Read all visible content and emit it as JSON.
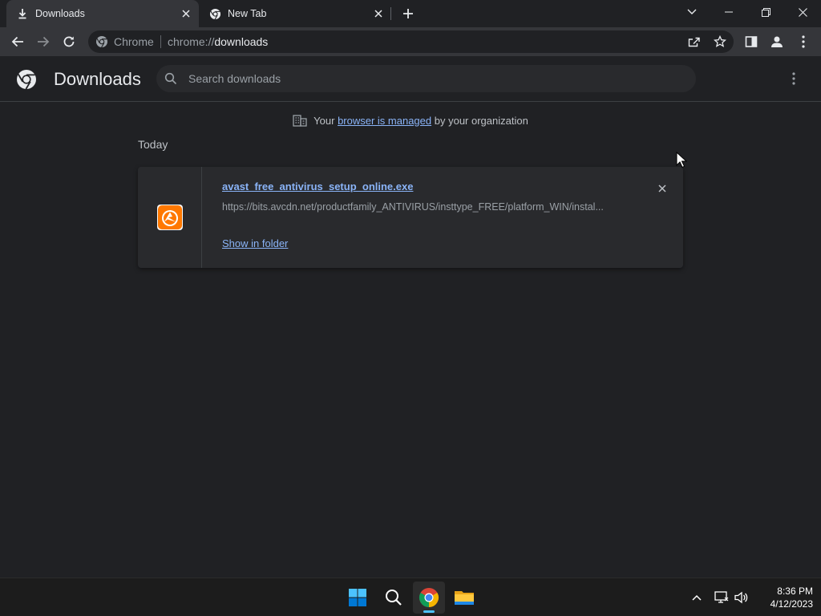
{
  "tabs": [
    {
      "title": "Downloads",
      "icon": "download-icon",
      "active": true
    },
    {
      "title": "New Tab",
      "icon": "chrome-icon",
      "active": false
    }
  ],
  "toolbar": {
    "site_chip": "Chrome",
    "url_scheme": "chrome://",
    "url_host": "downloads"
  },
  "downloads_page": {
    "title": "Downloads",
    "search_placeholder": "Search downloads",
    "managed_prefix": "Your",
    "managed_link": "browser is managed",
    "managed_suffix": "by your organization",
    "date_heading": "Today",
    "items": [
      {
        "file_name": "avast_free_antivirus_setup_online.exe",
        "url": "https://bits.avcdn.net/productfamily_ANTIVIRUS/insttype_FREE/platform_WIN/instal...",
        "action": "Show in folder",
        "icon": "avast-icon"
      }
    ]
  },
  "taskbar": {
    "apps": [
      "windows-start-icon",
      "search-icon",
      "chrome-icon",
      "file-explorer-icon"
    ],
    "time": "8:36 PM",
    "date": "4/12/2023"
  },
  "colors": {
    "background": "#202124",
    "toolbar": "#35363a",
    "link": "#8ab4f8",
    "card": "#292a2d",
    "avast_orange": "#ff7800"
  }
}
